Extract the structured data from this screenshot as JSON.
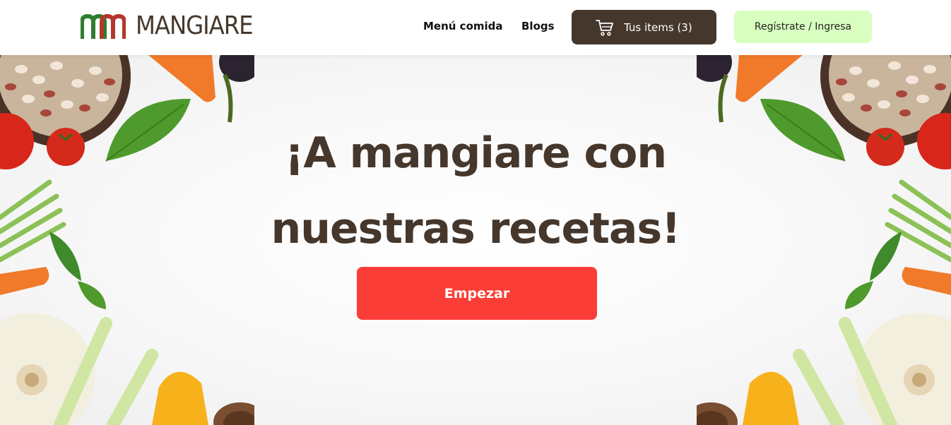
{
  "header": {
    "logo_text": "MANGIARE",
    "nav": {
      "menu_label": "Menú comida",
      "blogs_label": "Blogs"
    },
    "cart": {
      "label": "Tus items (3)",
      "icon": "cart-icon"
    },
    "register_label": "Regístrate / Ingresa"
  },
  "hero": {
    "title": "¡A mangiare con nuestras recetas!",
    "cta_label": "Empezar"
  },
  "colors": {
    "brand_brown": "#45372c",
    "cta_red": "#fa3e37",
    "register_green": "#d9ffc0",
    "logo_green": "#2f7d2f",
    "logo_red": "#b2372c"
  }
}
